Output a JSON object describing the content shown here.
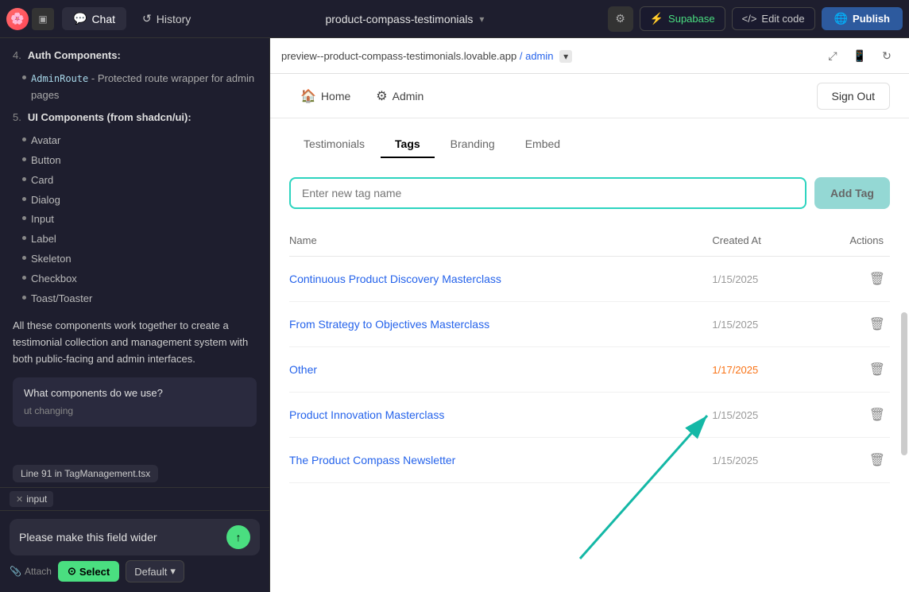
{
  "topbar": {
    "logo_emoji": "🌸",
    "chat_label": "Chat",
    "history_label": "History",
    "project_name": "product-compass-testimonials",
    "settings_icon": "⚙",
    "supabase_label": "Supabase",
    "edit_code_label": "Edit code",
    "publish_label": "Publish"
  },
  "preview_bar": {
    "url": "preview--product-compass-testimonials.lovable.app",
    "path": "/ admin",
    "expand_icon": "⤢",
    "mobile_icon": "📱",
    "refresh_icon": "↻"
  },
  "app": {
    "nav": [
      {
        "label": "Home",
        "icon": "🏠"
      },
      {
        "label": "Admin",
        "icon": "⚙"
      }
    ],
    "sign_out_label": "Sign Out",
    "tabs": [
      {
        "label": "Testimonials",
        "active": false
      },
      {
        "label": "Tags",
        "active": true
      },
      {
        "label": "Branding",
        "active": false
      },
      {
        "label": "Embed",
        "active": false
      }
    ],
    "tag_input_placeholder": "Enter new tag name",
    "add_tag_label": "Add Tag",
    "table": {
      "headers": [
        "Name",
        "Created At",
        "Actions"
      ],
      "rows": [
        {
          "name": "Continuous Product Discovery Masterclass",
          "date": "1/15/2025",
          "date_style": "normal"
        },
        {
          "name": "From Strategy to Objectives Masterclass",
          "date": "1/15/2025",
          "date_style": "normal"
        },
        {
          "name": "Other",
          "date": "1/17/2025",
          "date_style": "orange"
        },
        {
          "name": "Product Innovation Masterclass",
          "date": "1/15/2025",
          "date_style": "normal"
        },
        {
          "name": "The Product Compass Newsletter",
          "date": "1/15/2025",
          "date_style": "normal"
        }
      ]
    }
  },
  "sidebar": {
    "items": [
      {
        "num": "4.",
        "title": "Auth Components:",
        "bullets": [
          {
            "code": "AdminRoute",
            "text": " - Protected route wrapper for admin pages"
          }
        ]
      },
      {
        "num": "5.",
        "title": "UI Components (from shadcn/ui):",
        "bullets": [
          {
            "text": "Avatar"
          },
          {
            "text": "Button"
          },
          {
            "text": "Card"
          },
          {
            "text": "Dialog"
          },
          {
            "text": "Input"
          },
          {
            "text": "Label"
          },
          {
            "text": "Skeleton"
          },
          {
            "text": "Checkbox"
          },
          {
            "text": "Toast/Toaster"
          }
        ]
      }
    ],
    "summary": "All these components work together to create a testimonial collection and management system with both public-facing and admin interfaces.",
    "question_bubble": "What components do we use?",
    "question_continuation": "ut changing",
    "file_tooltip": "Line 91 in TagManagement.tsx",
    "file_chip_label": "input",
    "input_text": "Please make this field wider",
    "attach_label": "Attach",
    "select_label": "Select",
    "default_label": "Default"
  }
}
